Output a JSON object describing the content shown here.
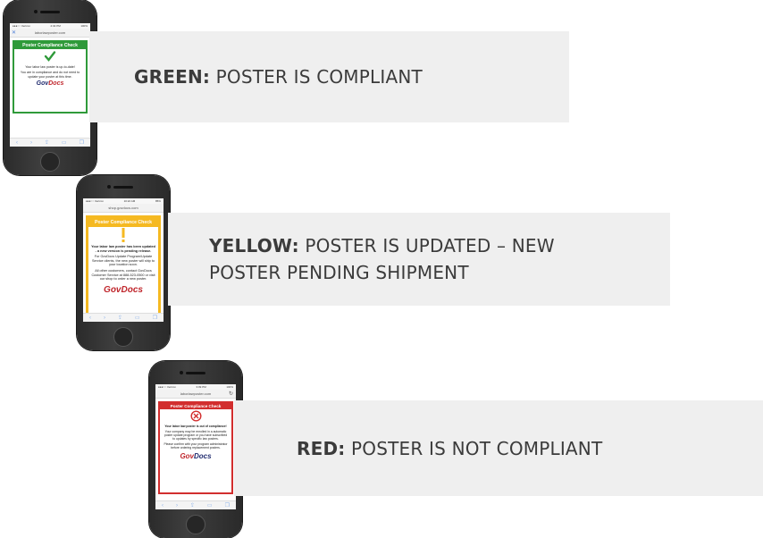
{
  "captions": {
    "green": {
      "lead": "GREEN:",
      "line1": "POSTER IS COMPLIANT",
      "line2": ""
    },
    "yellow": {
      "lead": "YELLOW:",
      "line1": "POSTER IS UPDATED – NEW",
      "line2": "POSTER PENDING SHIPMENT"
    },
    "red": {
      "lead": "RED:",
      "line1": "POSTER IS NOT COMPLIANT",
      "line2": ""
    }
  },
  "phones": {
    "green": {
      "status_left": "●●●○○ Verizon",
      "status_time": "2:32 PM",
      "status_right": "100%",
      "url": "laborlawposter.com",
      "card_title": "Poster Compliance Check",
      "status_icon": "check-icon",
      "message": "Your labor law poster is up-to-date!",
      "detail": "You are in compliance and do not need to update your poster at this time.",
      "brand_a": "Gov",
      "brand_b": "Docs",
      "accent": "#2f9a3a"
    },
    "yellow": {
      "status_left": "●●●○○ Verizon",
      "status_time": "10:22 AM",
      "status_right": "85%",
      "url": "shop.govdocs.com",
      "card_title": "Poster Compliance Check",
      "status_icon": "exclamation-icon",
      "message": "Your labor law poster has been updated - a new version is pending release.",
      "detail": "For GovDocs Update Program/Update Service clients, the new poster will ship to your location soon.",
      "detail2": "All other customers, contact GovDocs Customer Service at 888-523-0500 or visit our shop to order a new poster.",
      "brand_a": "Gov",
      "brand_b": "Docs",
      "accent": "#f5b921"
    },
    "red": {
      "status_left": "●●●○○ Verizon",
      "status_time": "3:09 PM",
      "status_right": "100%",
      "url": "laborlawposter.com",
      "card_title": "Poster Compliance Check",
      "status_icon": "x-circle-icon",
      "message": "Your labor law poster is out of compliance!",
      "detail": "Your company may be enrolled in a automatic poster update program or you have subscribed to updates by specific law posters.",
      "detail2": "Please confirm with your program administrator before ordering replacement posters.",
      "brand_a": "Gov",
      "brand_b": "Docs",
      "accent": "#d22e2e"
    }
  }
}
